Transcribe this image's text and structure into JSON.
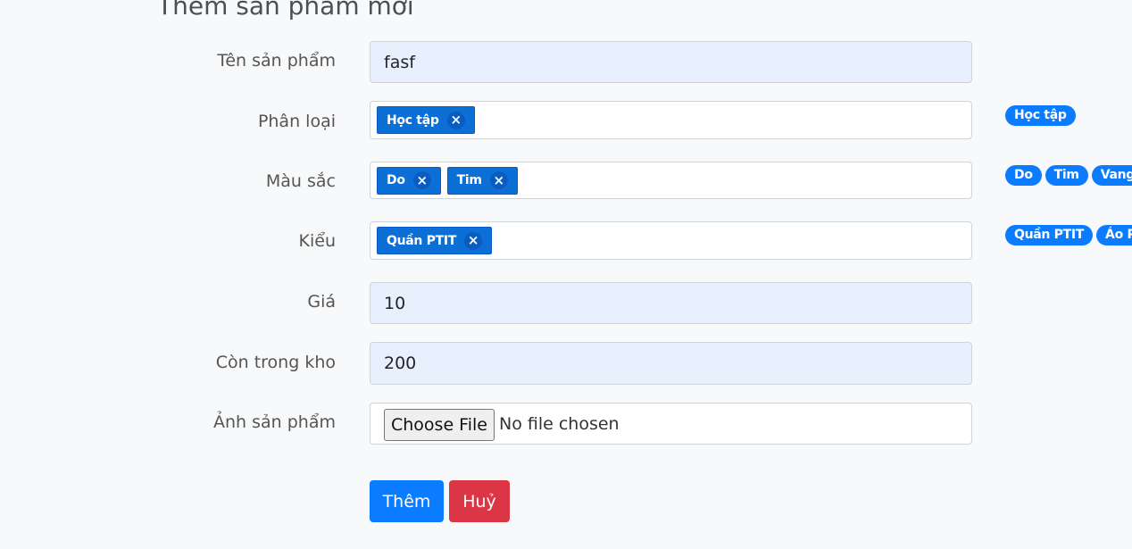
{
  "page_title": "Thêm sản phẩm mới",
  "form": {
    "name": {
      "label": "Tên sản phẩm",
      "value": "fasf"
    },
    "category": {
      "label": "Phân loại",
      "selected": [
        "Học tập"
      ],
      "options": [
        "Học tập"
      ]
    },
    "color": {
      "label": "Màu sắc",
      "selected": [
        "Do",
        "Tim"
      ],
      "options": [
        "Do",
        "Tim",
        "Vang"
      ]
    },
    "style": {
      "label": "Kiểu",
      "selected": [
        "Quần PTIT"
      ],
      "options": [
        "Quần PTIT",
        "Áo PT"
      ]
    },
    "price": {
      "label": "Giá",
      "value": "10"
    },
    "stock": {
      "label": "Còn trong kho",
      "value": "200"
    },
    "image": {
      "label": "Ảnh sản phẩm",
      "button_label": "Choose File",
      "status": "No file chosen"
    }
  },
  "actions": {
    "submit_label": "Thêm",
    "cancel_label": "Huỷ"
  },
  "tag_remove_glyph": "×",
  "colors": {
    "primary": "#0b7bff",
    "danger": "#dc3545",
    "autofill_bg": "#e8f0fe"
  }
}
